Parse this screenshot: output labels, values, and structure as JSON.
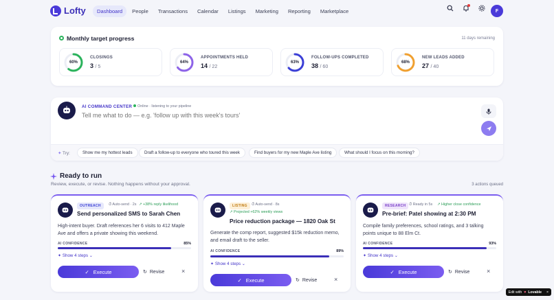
{
  "brand": {
    "name": "Lofty"
  },
  "nav": {
    "items": [
      "Dashboard",
      "People",
      "Transactions",
      "Calendar",
      "Listings",
      "Marketing",
      "Reporting",
      "Marketplace"
    ],
    "active": "Dashboard",
    "avatar_initial": "F"
  },
  "target": {
    "title": "Monthly target progress",
    "days_remaining": "11 days remaining",
    "kpis": [
      {
        "label": "CLOSINGS",
        "percent_text": "60%",
        "progress": 0.6,
        "value": "3",
        "total": "/ 5",
        "color": "#2bb35c"
      },
      {
        "label": "APPOINTMENTS HELD",
        "percent_text": "64%",
        "progress": 0.64,
        "value": "14",
        "total": "/ 22",
        "color": "#8d63e8"
      },
      {
        "label": "FOLLOW-UPS COMPLETED",
        "percent_text": "63%",
        "progress": 0.63,
        "value": "38",
        "total": "/ 60",
        "color": "#3b3fd6"
      },
      {
        "label": "NEW LEADS ADDED",
        "percent_text": "68%",
        "progress": 0.68,
        "value": "27",
        "total": "/ 40",
        "color": "#f0a030"
      }
    ]
  },
  "command": {
    "label": "AI COMMAND CENTER",
    "status": "Online · listening to your pipeline",
    "placeholder": "Tell me what to do — e.g. 'follow up with this week's tours'",
    "try_label": "Try:",
    "suggestions": [
      "Show me my hottest leads",
      "Draft a follow-up to everyone who toured this week",
      "Find buyers for my new Maple Ave listing",
      "What should I focus on this morning?"
    ]
  },
  "ready": {
    "title": "Ready to run",
    "subtitle": "Review, execute, or revise. Nothing happens without your approval.",
    "queued": "3 actions queued"
  },
  "actions": [
    {
      "tag": "OUTREACH",
      "tag_color": "#3b3fd6",
      "tag_bg": "#e6e8fb",
      "mode": "Auto-send · 2s",
      "lift": "+38% reply likelihood",
      "title": "Send personalized SMS to Sarah Chen",
      "desc": "High-intent buyer. Draft references her 6 visits to 412 Maple Ave and offers a private showing this weekend.",
      "conf_label": "AI CONFIDENCE",
      "conf_text": "85%",
      "confidence": 0.85,
      "steps": "Show 4 steps",
      "execute": "Execute",
      "revise": "Revise"
    },
    {
      "tag": "LISTING",
      "tag_color": "#c07a10",
      "tag_bg": "#fdf0d8",
      "mode": "Auto-send · 8s",
      "lift": "Projected +62% weekly views",
      "title": "Price reduction package — 1820 Oak St",
      "desc": "Generate the comp report, suggested $15k reduction memo, and email draft to the seller.",
      "conf_label": "AI CONFIDENCE",
      "conf_text": "89%",
      "confidence": 0.89,
      "steps": "Show 4 steps",
      "execute": "Execute",
      "revise": "Revise"
    },
    {
      "tag": "RESEARCH",
      "tag_color": "#7a3fc8",
      "tag_bg": "#efe4fb",
      "mode": "Ready in 5s",
      "lift": "Higher close confidence",
      "title": "Pre-brief: Patel showing at 2:30 PM",
      "desc": "Compile family preferences, school ratings, and 3 talking points unique to 88 Elm Ct.",
      "conf_label": "AI CONFIDENCE",
      "conf_text": "93%",
      "confidence": 0.93,
      "steps": "Show 4 steps",
      "execute": "Execute",
      "revise": "Revise"
    }
  ],
  "badge": {
    "text": "Edit with",
    "brand": "Lovable"
  }
}
